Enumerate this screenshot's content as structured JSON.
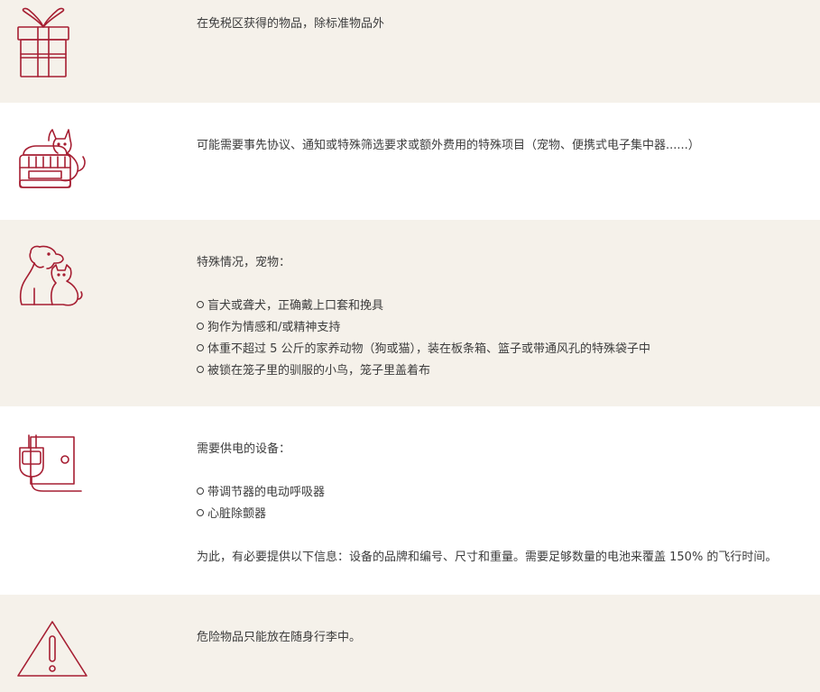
{
  "sections": [
    {
      "icon": "gift-icon",
      "lines": [
        "在免税区获得的物品，除标准物品外"
      ]
    },
    {
      "icon": "pet-carrier-cat-icon",
      "lines": [
        "可能需要事先协议、通知或特殊筛选要求或额外费用的特殊项目（宠物、便携式电子集中器......）"
      ]
    },
    {
      "icon": "dog-cat-icon",
      "title": "特殊情况，宠物：",
      "bullets": [
        "盲犬或聋犬，正确戴上口套和挽具",
        "狗作为情感和/或精神支持",
        "体重不超过 5 公斤的家养动物（狗或猫），装在板条箱、篮子或带通风孔的特殊袋子中",
        "被锁在笼子里的驯服的小鸟，笼子里盖着布"
      ]
    },
    {
      "icon": "power-plug-icon",
      "title": "需要供电的设备：",
      "bullets": [
        "带调节器的电动呼吸器",
        "心脏除颤器"
      ],
      "note": "为此，有必要提供以下信息：设备的品牌和编号、尺寸和重量。需要足够数量的电池来覆盖 150% 的飞行时间。"
    },
    {
      "icon": "warning-triangle-icon",
      "lines": [
        "危险物品只能放在随身行李中。"
      ]
    }
  ],
  "colors": {
    "icon_stroke": "#a61e32",
    "beige_bg": "#f5f1ea",
    "text": "#3c3c3c"
  }
}
